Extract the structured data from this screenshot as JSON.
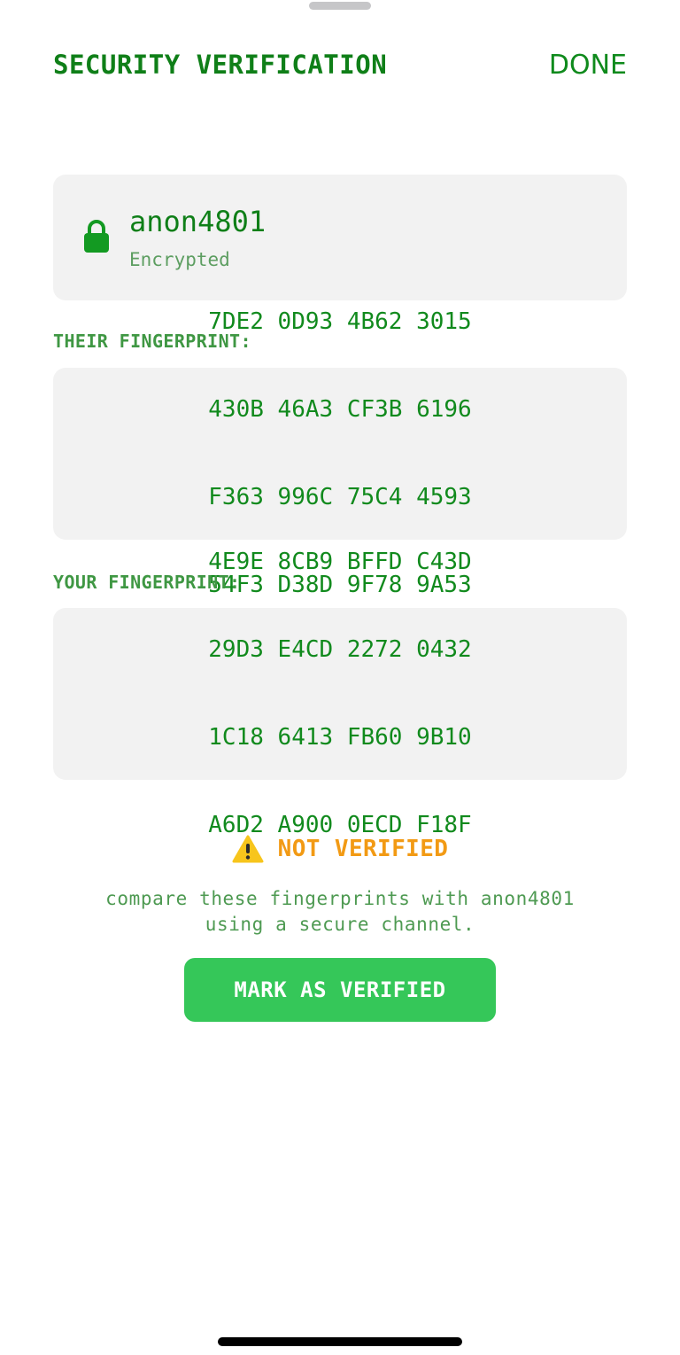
{
  "header": {
    "title": "SECURITY VERIFICATION",
    "done_label": "DONE"
  },
  "contact": {
    "name": "anon4801",
    "status": "Encrypted",
    "icon": "lock-icon"
  },
  "their_fingerprint": {
    "label": "THEIR FINGERPRINT:",
    "lines": [
      "7DE2 0D93 4B62 3015",
      "430B 46A3 CF3B 6196",
      "F363 996C 75C4 4593",
      "54F3 D38D 9F78 9A53"
    ]
  },
  "your_fingerprint": {
    "label": "YOUR FINGERPRINT:",
    "lines": [
      "4E9E 8CB9 BFFD C43D",
      "29D3 E4CD 2272 0432",
      "1C18 6413 FB60 9B10",
      "A6D2 A900 0ECD F18F"
    ]
  },
  "verification": {
    "status": "NOT VERIFIED",
    "icon": "warning-icon",
    "instructions_line1": "compare these fingerprints with anon4801",
    "instructions_line2": "using a secure channel.",
    "button_label": "MARK AS VERIFIED"
  },
  "colors": {
    "accent_green": "#0f7f18",
    "button_green": "#35c759",
    "warning_orange": "#f29a14",
    "card_background": "#f2f2f2"
  }
}
